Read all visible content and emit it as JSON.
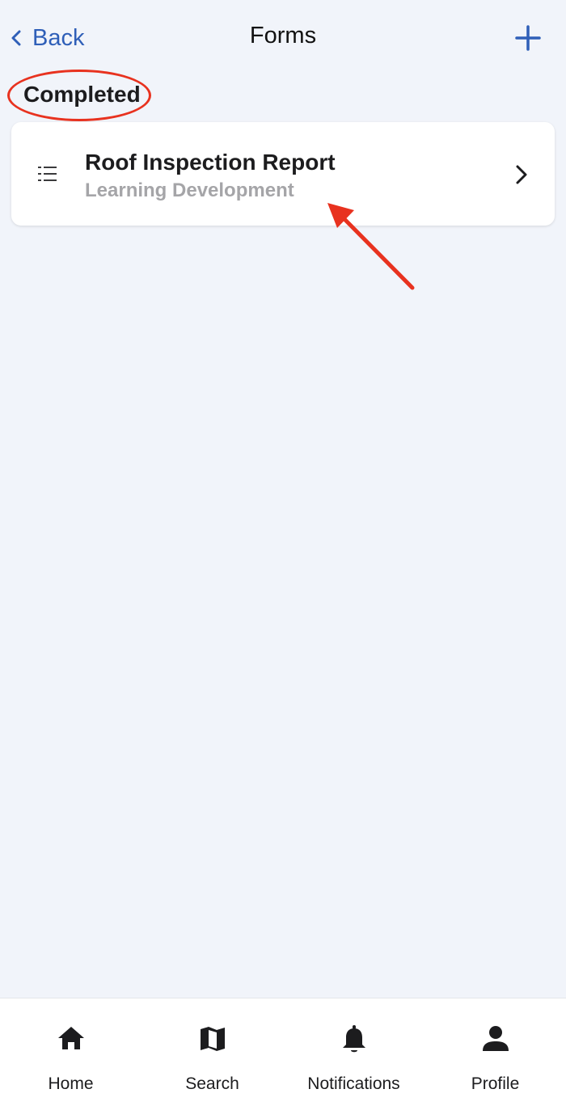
{
  "header": {
    "back_label": "Back",
    "title": "Forms",
    "add_icon": "plus-icon"
  },
  "section": {
    "heading": "Completed"
  },
  "forms": [
    {
      "title": "Roof Inspection Report",
      "subtitle": "Learning Development",
      "icon": "numbered-list-icon"
    }
  ],
  "tab_bar": {
    "tabs": [
      {
        "label": "Home",
        "icon": "home-icon"
      },
      {
        "label": "Search",
        "icon": "map-icon"
      },
      {
        "label": "Notifications",
        "icon": "bell-icon"
      },
      {
        "label": "Profile",
        "icon": "person-icon"
      }
    ]
  },
  "colors": {
    "background": "#f1f4fa",
    "accent": "#2f5fb8",
    "annotation": "#e8321f",
    "subtitle": "#a5a5a8"
  }
}
